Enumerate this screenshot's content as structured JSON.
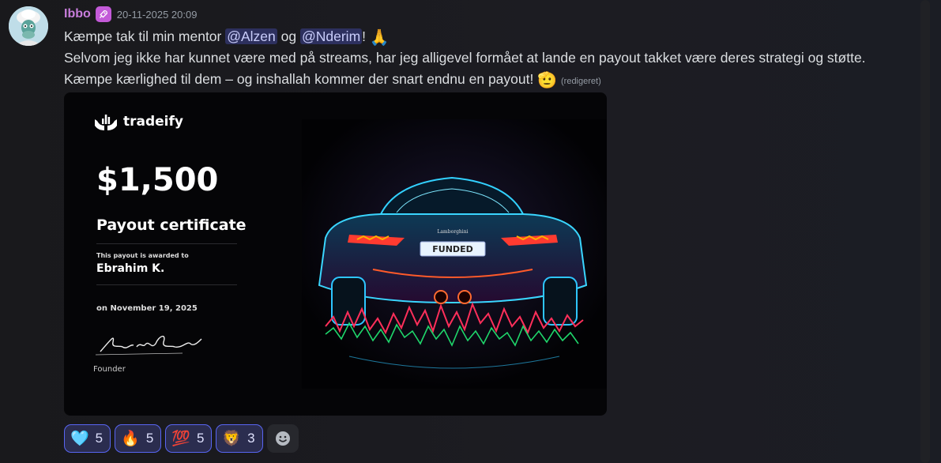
{
  "message": {
    "username": "Ibbo",
    "timestamp": "20-11-2025 20:09",
    "text_part1": "Kæmpe tak til min mentor ",
    "mention1": "@Alzen",
    "text_part2": " og ",
    "mention2": "@Nderim",
    "text_part3": "! ",
    "pray_emoji": "🙏",
    "text_line2": "Selvom jeg ikke har kunnet være med på streams, har jeg alligevel formået at lande en payout takket være deres strategi og støtte. Kæmpe kærlighed til dem – og inshallah kommer der snart endnu en payout! ",
    "salute_emoji": "🫡",
    "edited_label": "(redigeret)",
    "role_badge_icon": "rocket-icon"
  },
  "certificate": {
    "brand": "tradeify",
    "amount": "$1,500",
    "title": "Payout certificate",
    "awarded_label": "This payout is awarded to",
    "recipient": "Ebrahim K.",
    "date": "on November 19, 2025",
    "signature": "Brett Simberkoff",
    "role": "Founder",
    "plate": "FUNDED",
    "car_badge": "Lamborghini"
  },
  "reactions": [
    {
      "emoji": "🩵",
      "icon": "light-blue-heart-icon",
      "count": "5"
    },
    {
      "emoji": "🔥",
      "icon": "fire-icon",
      "count": "5"
    },
    {
      "emoji": "💯",
      "icon": "hundred-points-icon",
      "count": "5"
    },
    {
      "emoji": "🦁",
      "icon": "lion-icon",
      "count": "3"
    }
  ],
  "colors": {
    "username": "#c77ddb",
    "mention_bg": "#3a3f7a",
    "reaction_border": "#5865f2",
    "background": "#1a1a1e"
  }
}
